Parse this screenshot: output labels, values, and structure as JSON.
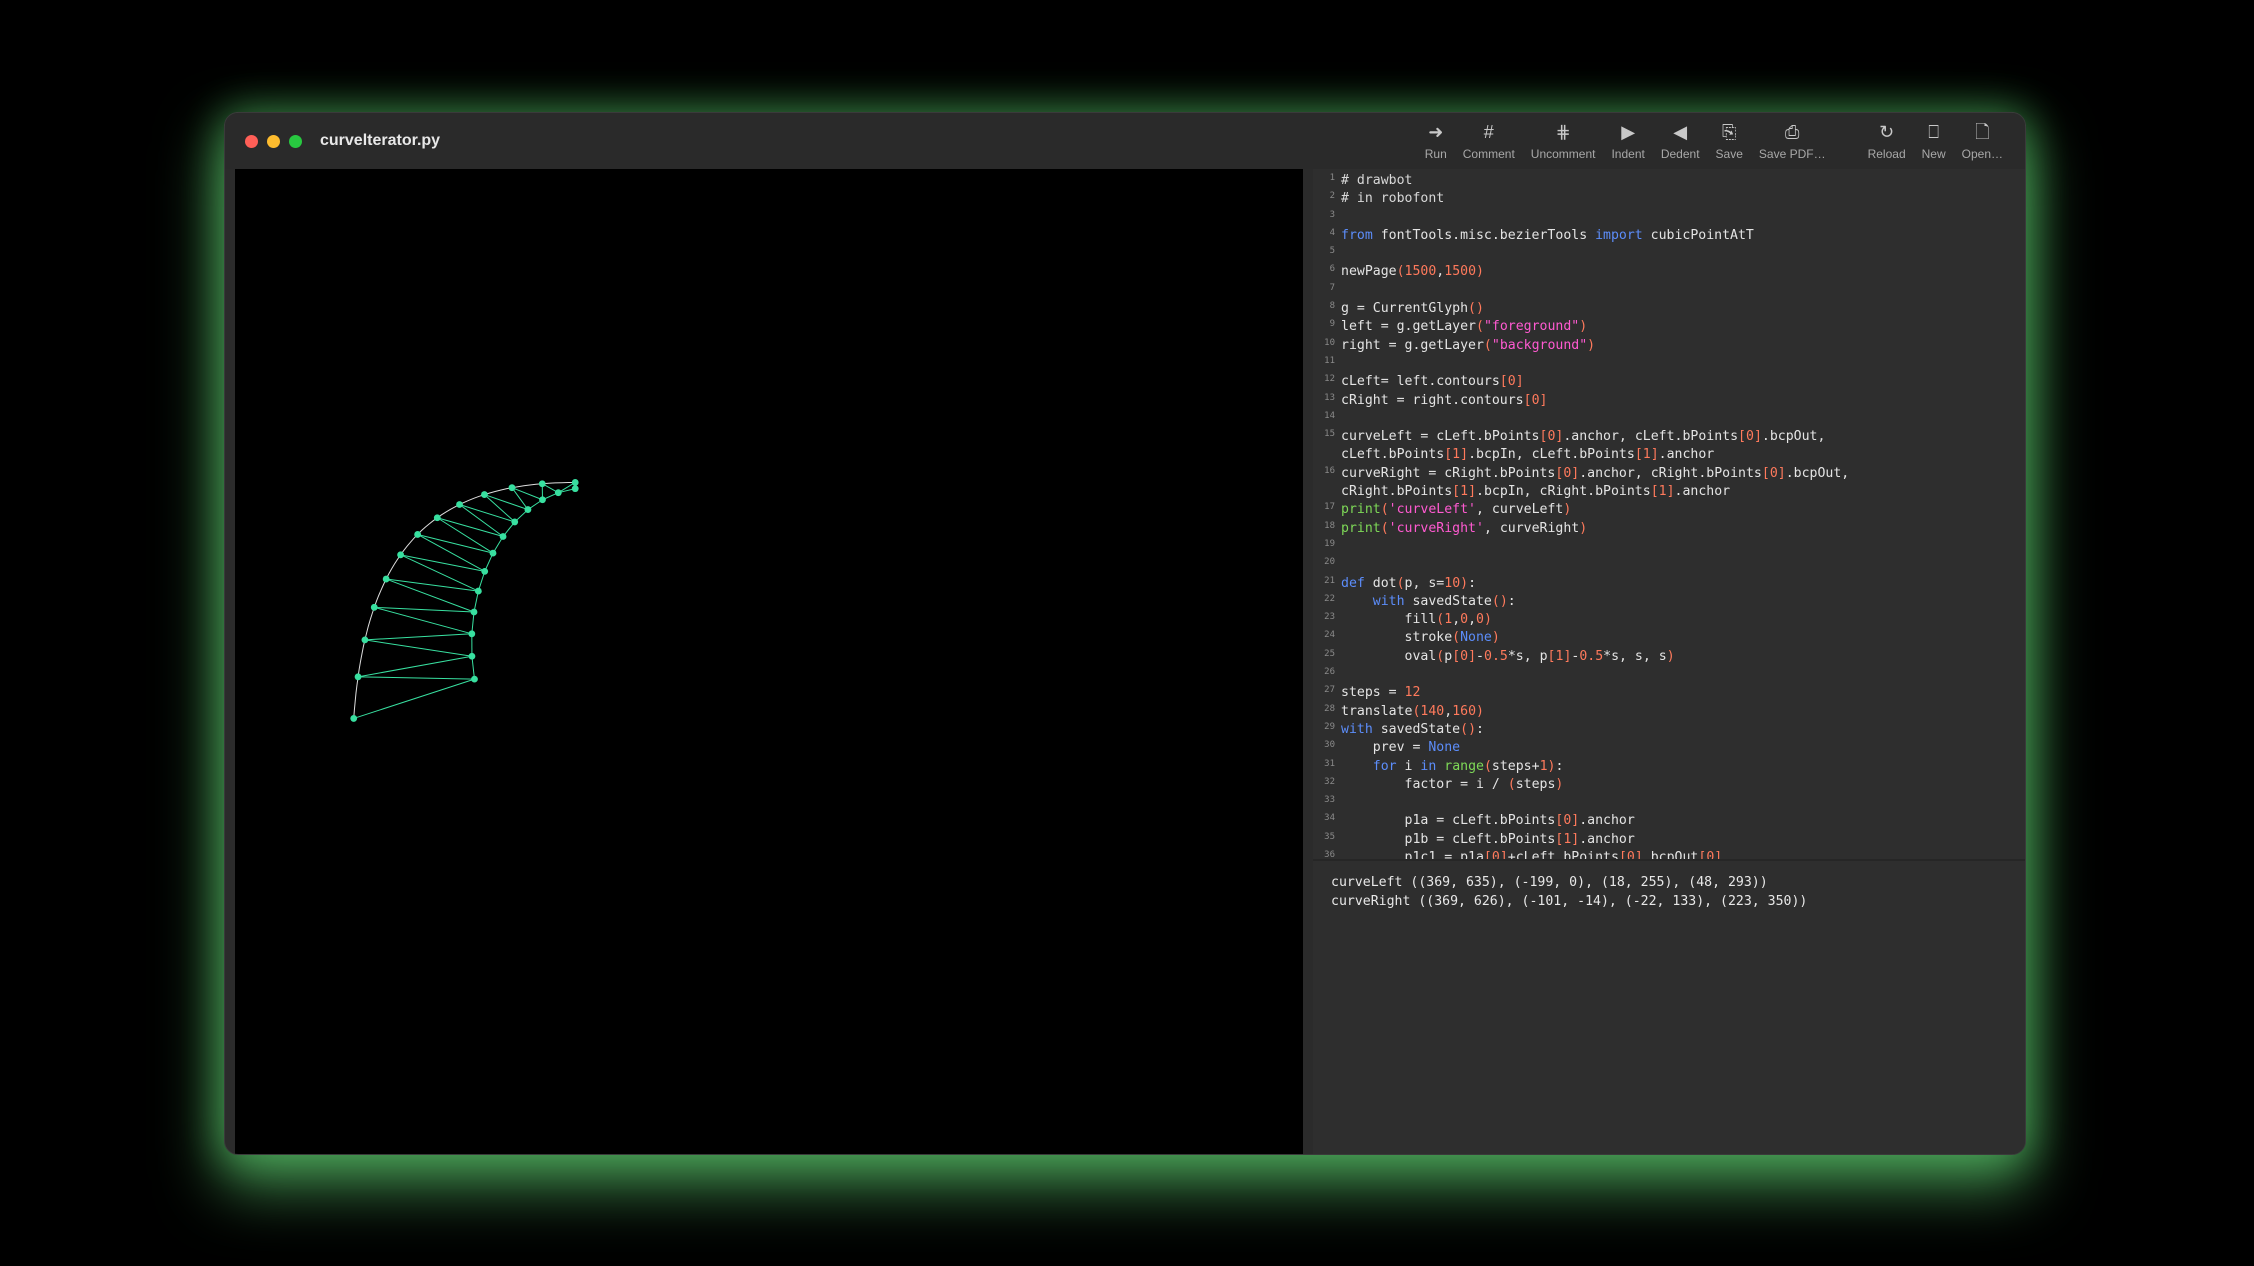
{
  "window": {
    "title": "curvelterator.py"
  },
  "toolbar": [
    {
      "icon": "run-icon",
      "glyph": "➜",
      "label": "Run"
    },
    {
      "icon": "comment-icon",
      "glyph": "#",
      "label": "Comment"
    },
    {
      "icon": "uncomment-icon",
      "glyph": "⋕",
      "label": "Uncomment"
    },
    {
      "icon": "indent-icon",
      "glyph": "▶",
      "label": "Indent"
    },
    {
      "icon": "dedent-icon",
      "glyph": "◀",
      "label": "Dedent"
    },
    {
      "icon": "save-icon",
      "glyph": "⎘",
      "label": "Save"
    },
    {
      "icon": "save-pdf-icon",
      "glyph": "⎙",
      "label": "Save PDF…"
    },
    {
      "icon": "reload-icon",
      "glyph": "↻",
      "label": "Reload"
    },
    {
      "icon": "new-icon",
      "glyph": "⎕",
      "label": "New"
    },
    {
      "icon": "open-icon",
      "glyph": "🗋",
      "label": "Open…"
    }
  ],
  "code_lines": [
    {
      "n": "1",
      "text": "# drawbot"
    },
    {
      "n": "2",
      "text": "# in robofont"
    },
    {
      "n": "3",
      "text": ""
    },
    {
      "n": "4",
      "text": "from fontTools.misc.bezierTools import cubicPointAtT"
    },
    {
      "n": "5",
      "text": ""
    },
    {
      "n": "6",
      "text": "newPage(1500,1500)"
    },
    {
      "n": "7",
      "text": ""
    },
    {
      "n": "8",
      "text": "g = CurrentGlyph()"
    },
    {
      "n": "9",
      "text": "left = g.getLayer(\"foreground\")"
    },
    {
      "n": "10",
      "text": "right = g.getLayer(\"background\")"
    },
    {
      "n": "11",
      "text": ""
    },
    {
      "n": "12",
      "text": "cLeft= left.contours[0]"
    },
    {
      "n": "13",
      "text": "cRight = right.contours[0]"
    },
    {
      "n": "14",
      "text": ""
    },
    {
      "n": "15",
      "text": "curveLeft = cLeft.bPoints[0].anchor, cLeft.bPoints[0].bcpOut,"
    },
    {
      "n": "",
      "text": "cLeft.bPoints[1].bcpIn, cLeft.bPoints[1].anchor"
    },
    {
      "n": "16",
      "text": "curveRight = cRight.bPoints[0].anchor, cRight.bPoints[0].bcpOut,"
    },
    {
      "n": "",
      "text": "cRight.bPoints[1].bcpIn, cRight.bPoints[1].anchor"
    },
    {
      "n": "17",
      "text": "print('curveLeft', curveLeft)"
    },
    {
      "n": "18",
      "text": "print('curveRight', curveRight)"
    },
    {
      "n": "19",
      "text": ""
    },
    {
      "n": "20",
      "text": ""
    },
    {
      "n": "21",
      "text": "def dot(p, s=10):"
    },
    {
      "n": "22",
      "text": "    with savedState():"
    },
    {
      "n": "23",
      "text": "        fill(1,0,0)"
    },
    {
      "n": "24",
      "text": "        stroke(None)"
    },
    {
      "n": "25",
      "text": "        oval(p[0]-0.5*s, p[1]-0.5*s, s, s)"
    },
    {
      "n": "26",
      "text": ""
    },
    {
      "n": "27",
      "text": "steps = 12"
    },
    {
      "n": "28",
      "text": "translate(140,160)"
    },
    {
      "n": "29",
      "text": "with savedState():"
    },
    {
      "n": "30",
      "text": "    prev = None"
    },
    {
      "n": "31",
      "text": "    for i in range(steps+1):"
    },
    {
      "n": "32",
      "text": "        factor = i / (steps)"
    },
    {
      "n": "33",
      "text": ""
    },
    {
      "n": "34",
      "text": "        p1a = cLeft.bPoints[0].anchor"
    },
    {
      "n": "35",
      "text": "        p1b = cLeft.bPoints[1].anchor"
    },
    {
      "n": "36",
      "text": "        p1c1 = p1a[0]+cLeft.bPoints[0].bcpOut[0]"
    }
  ],
  "output": [
    "curveLeft ((369, 635), (-199, 0), (18, 255), (48, 293))",
    "curveRight ((369, 626), (-101, -14), (-22, 133), (223, 350))"
  ],
  "drawing": {
    "curve_left": [
      [
        369,
        635
      ],
      [
        -199,
        0
      ],
      [
        18,
        255
      ],
      [
        48,
        293
      ]
    ],
    "curve_right": [
      [
        369,
        626
      ],
      [
        -101,
        -14
      ],
      [
        -22,
        133
      ],
      [
        223,
        350
      ]
    ],
    "steps": 12,
    "translate": [
      140,
      160
    ],
    "color": "#38e0a0"
  }
}
